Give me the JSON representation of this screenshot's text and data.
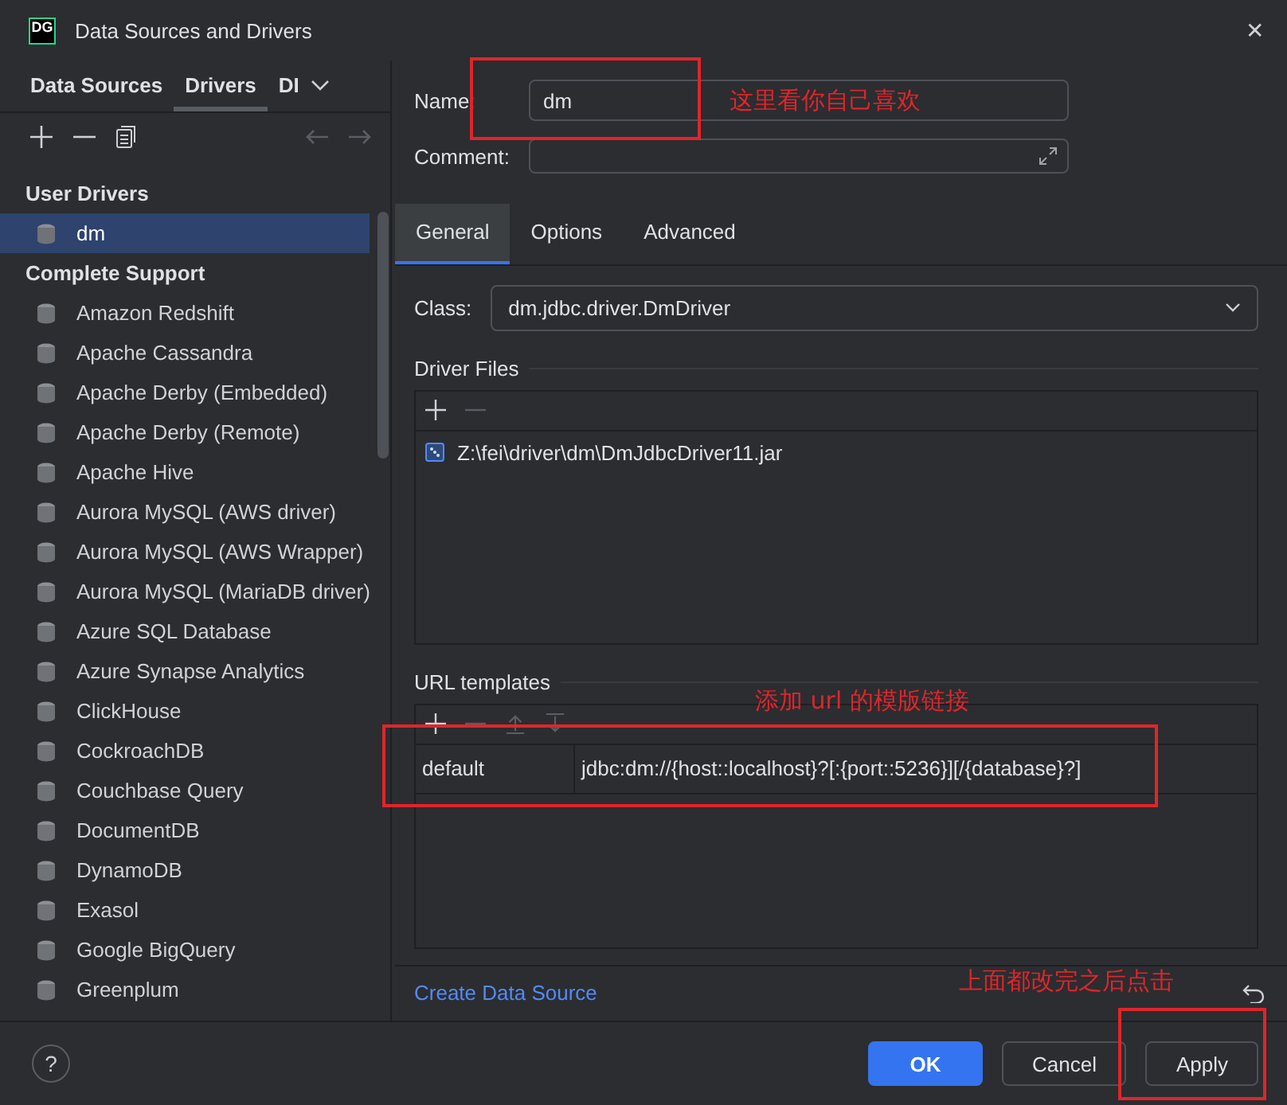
{
  "window": {
    "logo": "DG",
    "title": "Data Sources and Drivers",
    "close": "✕"
  },
  "sidebar": {
    "tabs": [
      {
        "label": "Data Sources",
        "selected": false
      },
      {
        "label": "Drivers",
        "selected": true
      },
      {
        "label": "DI",
        "selected": false
      }
    ],
    "items": [
      {
        "kind": "header",
        "label": "User Drivers"
      },
      {
        "kind": "driver",
        "label": "dm",
        "selected": true
      },
      {
        "kind": "header",
        "label": "Complete Support"
      },
      {
        "kind": "driver",
        "label": "Amazon Redshift",
        "selected": false
      },
      {
        "kind": "driver",
        "label": "Apache Cassandra",
        "selected": false
      },
      {
        "kind": "driver",
        "label": "Apache Derby (Embedded)",
        "selected": false
      },
      {
        "kind": "driver",
        "label": "Apache Derby (Remote)",
        "selected": false
      },
      {
        "kind": "driver",
        "label": "Apache Hive",
        "selected": false
      },
      {
        "kind": "driver",
        "label": "Aurora MySQL (AWS driver)",
        "selected": false
      },
      {
        "kind": "driver",
        "label": "Aurora MySQL (AWS Wrapper)",
        "selected": false
      },
      {
        "kind": "driver",
        "label": "Aurora MySQL (MariaDB driver)",
        "selected": false
      },
      {
        "kind": "driver",
        "label": "Azure SQL Database",
        "selected": false
      },
      {
        "kind": "driver",
        "label": "Azure Synapse Analytics",
        "selected": false
      },
      {
        "kind": "driver",
        "label": "ClickHouse",
        "selected": false
      },
      {
        "kind": "driver",
        "label": "CockroachDB",
        "selected": false
      },
      {
        "kind": "driver",
        "label": "Couchbase Query",
        "selected": false
      },
      {
        "kind": "driver",
        "label": "DocumentDB",
        "selected": false
      },
      {
        "kind": "driver",
        "label": "DynamoDB",
        "selected": false
      },
      {
        "kind": "driver",
        "label": "Exasol",
        "selected": false
      },
      {
        "kind": "driver",
        "label": "Google BigQuery",
        "selected": false
      },
      {
        "kind": "driver",
        "label": "Greenplum",
        "selected": false
      }
    ]
  },
  "form": {
    "name_label": "Name:",
    "name_value": "dm",
    "comment_label": "Comment:"
  },
  "tabs": [
    {
      "label": "General",
      "selected": true
    },
    {
      "label": "Options",
      "selected": false
    },
    {
      "label": "Advanced",
      "selected": false
    }
  ],
  "class_label": "Class:",
  "class_value": "dm.jdbc.driver.DmDriver",
  "driver_files": {
    "title": "Driver Files",
    "files": [
      "Z:\\fei\\driver\\dm\\DmJdbcDriver11.jar"
    ]
  },
  "url_templates": {
    "title": "URL templates",
    "rows": [
      {
        "name": "default",
        "url": "jdbc:dm://{host::localhost}?[:{port::5236}][/{database}?]"
      }
    ]
  },
  "create_link": "Create Data Source",
  "buttons": [
    {
      "label": "OK",
      "kind": "primary"
    },
    {
      "label": "Cancel",
      "kind": "normal"
    },
    {
      "label": "Apply",
      "kind": "normal"
    }
  ],
  "help": "?",
  "annotations": [
    "这里看你自己喜欢",
    "添加 url 的模版链接",
    "上面都改完之后点击"
  ]
}
